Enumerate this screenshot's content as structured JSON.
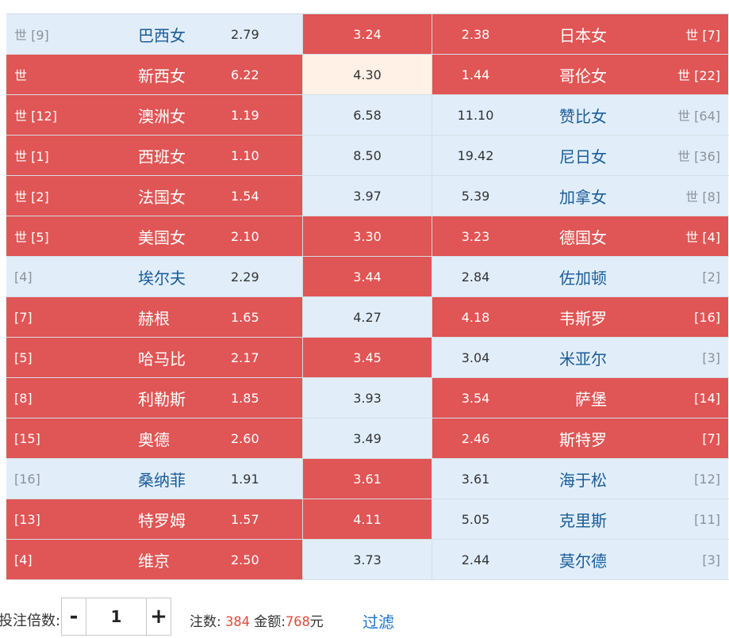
{
  "matches": [
    {
      "home_rank": "世 [9]",
      "home_team": "巴西女",
      "home_odds": "2.79",
      "draw_odds": "3.24",
      "away_odds": "2.38",
      "away_team": "日本女",
      "away_rank": "世 [7]",
      "home_state": "light",
      "draw_state": "red",
      "away_state": "red"
    },
    {
      "home_rank": "世",
      "home_team": "新西女",
      "home_odds": "6.22",
      "draw_odds": "4.30",
      "away_odds": "1.44",
      "away_team": "哥伦女",
      "away_rank": "世 [22]",
      "home_state": "red",
      "draw_state": "peach",
      "away_state": "red"
    },
    {
      "home_rank": "世 [12]",
      "home_team": "澳洲女",
      "home_odds": "1.19",
      "draw_odds": "6.58",
      "away_odds": "11.10",
      "away_team": "赞比女",
      "away_rank": "世 [64]",
      "home_state": "red",
      "draw_state": "light",
      "away_state": "light"
    },
    {
      "home_rank": "世 [1]",
      "home_team": "西班女",
      "home_odds": "1.10",
      "draw_odds": "8.50",
      "away_odds": "19.42",
      "away_team": "尼日女",
      "away_rank": "世 [36]",
      "home_state": "red",
      "draw_state": "light",
      "away_state": "light"
    },
    {
      "home_rank": "世 [2]",
      "home_team": "法国女",
      "home_odds": "1.54",
      "draw_odds": "3.97",
      "away_odds": "5.39",
      "away_team": "加拿女",
      "away_rank": "世 [8]",
      "home_state": "red",
      "draw_state": "light",
      "away_state": "light"
    },
    {
      "home_rank": "世 [5]",
      "home_team": "美国女",
      "home_odds": "2.10",
      "draw_odds": "3.30",
      "away_odds": "3.23",
      "away_team": "德国女",
      "away_rank": "世 [4]",
      "home_state": "red",
      "draw_state": "red",
      "away_state": "red"
    },
    {
      "home_rank": "[4]",
      "home_team": "埃尔夫",
      "home_odds": "2.29",
      "draw_odds": "3.44",
      "away_odds": "2.84",
      "away_team": "佐加顿",
      "away_rank": "[2]",
      "home_state": "light",
      "draw_state": "red",
      "away_state": "light"
    },
    {
      "home_rank": "[7]",
      "home_team": "赫根",
      "home_odds": "1.65",
      "draw_odds": "4.27",
      "away_odds": "4.18",
      "away_team": "韦斯罗",
      "away_rank": "[16]",
      "home_state": "red",
      "draw_state": "light",
      "away_state": "red"
    },
    {
      "home_rank": "[5]",
      "home_team": "哈马比",
      "home_odds": "2.17",
      "draw_odds": "3.45",
      "away_odds": "3.04",
      "away_team": "米亚尔",
      "away_rank": "[3]",
      "home_state": "red",
      "draw_state": "red",
      "away_state": "light"
    },
    {
      "home_rank": "[8]",
      "home_team": "利勒斯",
      "home_odds": "1.85",
      "draw_odds": "3.93",
      "away_odds": "3.54",
      "away_team": "萨堡",
      "away_rank": "[14]",
      "home_state": "red",
      "draw_state": "light",
      "away_state": "red"
    },
    {
      "home_rank": "[15]",
      "home_team": "奥德",
      "home_odds": "2.60",
      "draw_odds": "3.49",
      "away_odds": "2.46",
      "away_team": "斯特罗",
      "away_rank": "[7]",
      "home_state": "red",
      "draw_state": "light",
      "away_state": "red"
    },
    {
      "home_rank": "[16]",
      "home_team": "桑纳菲",
      "home_odds": "1.91",
      "draw_odds": "3.61",
      "away_odds": "3.61",
      "away_team": "海于松",
      "away_rank": "[12]",
      "home_state": "light",
      "draw_state": "red",
      "away_state": "light"
    },
    {
      "home_rank": "[13]",
      "home_team": "特罗姆",
      "home_odds": "1.57",
      "draw_odds": "4.11",
      "away_odds": "5.05",
      "away_team": "克里斯",
      "away_rank": "[11]",
      "home_state": "red",
      "draw_state": "red",
      "away_state": "light"
    },
    {
      "home_rank": "[4]",
      "home_team": "维京",
      "home_odds": "2.50",
      "draw_odds": "3.73",
      "away_odds": "2.44",
      "away_team": "莫尔德",
      "away_rank": "[3]",
      "home_state": "red",
      "draw_state": "light",
      "away_state": "light"
    }
  ],
  "footer": {
    "multiplier_label": "投注倍数:",
    "minus_label": "-",
    "multiplier_value": "1",
    "plus_label": "+",
    "count_label": "注数:",
    "count_value": "384",
    "amount_label": "金额:",
    "amount_value": "768",
    "amount_unit": "元",
    "filter_label": "过滤"
  },
  "colors": {
    "selected_red": "#e05555",
    "unselected_blue": "#e1eefa",
    "highlight_peach": "#fff1e6",
    "team_blue": "#1a5c99",
    "accent_orange": "#e04a3a",
    "link_blue": "#1a73d0"
  }
}
